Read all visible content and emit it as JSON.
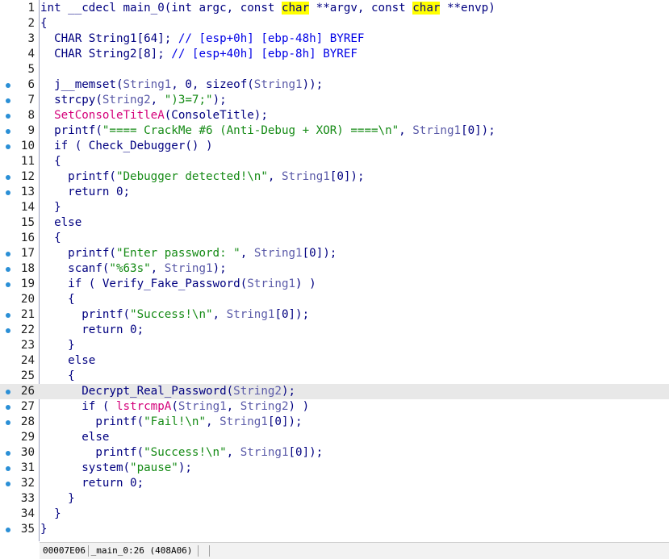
{
  "editor": {
    "highlighted_line": 26,
    "marker_color": "#2a8fd6",
    "lines": [
      {
        "num": "1",
        "dot": false,
        "tokens": [
          [
            "k",
            "int __cdecl main_0(int argc, const "
          ],
          [
            "y",
            "char"
          ],
          [
            "k",
            " **argv, const "
          ],
          [
            "y",
            "char"
          ],
          [
            "k",
            " **envp)"
          ]
        ]
      },
      {
        "num": "2",
        "dot": false,
        "tokens": [
          [
            "k",
            "{"
          ]
        ]
      },
      {
        "num": "3",
        "dot": false,
        "tokens": [
          [
            "k",
            "  CHAR String1[64]; "
          ],
          [
            "c",
            "// [esp+0h] [ebp-48h] BYREF"
          ]
        ]
      },
      {
        "num": "4",
        "dot": false,
        "tokens": [
          [
            "k",
            "  CHAR String2[8]; "
          ],
          [
            "c",
            "// [esp+40h] [ebp-8h] BYREF"
          ]
        ]
      },
      {
        "num": "5",
        "dot": false,
        "tokens": []
      },
      {
        "num": "6",
        "dot": true,
        "tokens": [
          [
            "k",
            "  j__memset("
          ],
          [
            "v",
            "String1"
          ],
          [
            "k",
            ", 0, sizeof("
          ],
          [
            "v",
            "String1"
          ],
          [
            "k",
            "));"
          ]
        ]
      },
      {
        "num": "7",
        "dot": true,
        "tokens": [
          [
            "k",
            "  strcpy("
          ],
          [
            "v",
            "String2"
          ],
          [
            "k",
            ", "
          ],
          [
            "s",
            "\")3=7;\""
          ],
          [
            "k",
            ");"
          ]
        ]
      },
      {
        "num": "8",
        "dot": true,
        "tokens": [
          [
            "k",
            "  "
          ],
          [
            "f",
            "SetConsoleTitleA"
          ],
          [
            "k",
            "(ConsoleTitle);"
          ]
        ]
      },
      {
        "num": "9",
        "dot": true,
        "tokens": [
          [
            "k",
            "  printf("
          ],
          [
            "s",
            "\"==== CrackMe #6 (Anti-Debug + XOR) ====\\n\""
          ],
          [
            "k",
            ", "
          ],
          [
            "v",
            "String1"
          ],
          [
            "k",
            "[0]);"
          ]
        ]
      },
      {
        "num": "10",
        "dot": true,
        "tokens": [
          [
            "k",
            "  if ( Check_Debugger() )"
          ]
        ]
      },
      {
        "num": "11",
        "dot": false,
        "tokens": [
          [
            "k",
            "  {"
          ]
        ]
      },
      {
        "num": "12",
        "dot": true,
        "tokens": [
          [
            "k",
            "    printf("
          ],
          [
            "s",
            "\"Debugger detected!\\n\""
          ],
          [
            "k",
            ", "
          ],
          [
            "v",
            "String1"
          ],
          [
            "k",
            "[0]);"
          ]
        ]
      },
      {
        "num": "13",
        "dot": true,
        "tokens": [
          [
            "k",
            "    return 0;"
          ]
        ]
      },
      {
        "num": "14",
        "dot": false,
        "tokens": [
          [
            "k",
            "  }"
          ]
        ]
      },
      {
        "num": "15",
        "dot": false,
        "tokens": [
          [
            "k",
            "  else"
          ]
        ]
      },
      {
        "num": "16",
        "dot": false,
        "tokens": [
          [
            "k",
            "  {"
          ]
        ]
      },
      {
        "num": "17",
        "dot": true,
        "tokens": [
          [
            "k",
            "    printf("
          ],
          [
            "s",
            "\"Enter password: \""
          ],
          [
            "k",
            ", "
          ],
          [
            "v",
            "String1"
          ],
          [
            "k",
            "[0]);"
          ]
        ]
      },
      {
        "num": "18",
        "dot": true,
        "tokens": [
          [
            "k",
            "    scanf("
          ],
          [
            "s",
            "\"%63s\""
          ],
          [
            "k",
            ", "
          ],
          [
            "v",
            "String1"
          ],
          [
            "k",
            ");"
          ]
        ]
      },
      {
        "num": "19",
        "dot": true,
        "tokens": [
          [
            "k",
            "    if ( Verify_Fake_Password("
          ],
          [
            "v",
            "String1"
          ],
          [
            "k",
            ") )"
          ]
        ]
      },
      {
        "num": "20",
        "dot": false,
        "tokens": [
          [
            "k",
            "    {"
          ]
        ]
      },
      {
        "num": "21",
        "dot": true,
        "tokens": [
          [
            "k",
            "      printf("
          ],
          [
            "s",
            "\"Success!\\n\""
          ],
          [
            "k",
            ", "
          ],
          [
            "v",
            "String1"
          ],
          [
            "k",
            "[0]);"
          ]
        ]
      },
      {
        "num": "22",
        "dot": true,
        "tokens": [
          [
            "k",
            "      return 0;"
          ]
        ]
      },
      {
        "num": "23",
        "dot": false,
        "tokens": [
          [
            "k",
            "    }"
          ]
        ]
      },
      {
        "num": "24",
        "dot": false,
        "tokens": [
          [
            "k",
            "    else"
          ]
        ]
      },
      {
        "num": "25",
        "dot": false,
        "tokens": [
          [
            "k",
            "    {"
          ]
        ]
      },
      {
        "num": "26",
        "dot": true,
        "tokens": [
          [
            "k",
            "      Decrypt_Real_Password("
          ],
          [
            "v",
            "String2"
          ],
          [
            "k",
            ");"
          ]
        ]
      },
      {
        "num": "27",
        "dot": true,
        "tokens": [
          [
            "k",
            "      if ( "
          ],
          [
            "f",
            "lstrcmpA"
          ],
          [
            "k",
            "("
          ],
          [
            "v",
            "String1"
          ],
          [
            "k",
            ", "
          ],
          [
            "v",
            "String2"
          ],
          [
            "k",
            ") )"
          ]
        ]
      },
      {
        "num": "28",
        "dot": true,
        "tokens": [
          [
            "k",
            "        printf("
          ],
          [
            "s",
            "\"Fail!\\n\""
          ],
          [
            "k",
            ", "
          ],
          [
            "v",
            "String1"
          ],
          [
            "k",
            "[0]);"
          ]
        ]
      },
      {
        "num": "29",
        "dot": false,
        "tokens": [
          [
            "k",
            "      else"
          ]
        ]
      },
      {
        "num": "30",
        "dot": true,
        "tokens": [
          [
            "k",
            "        printf("
          ],
          [
            "s",
            "\"Success!\\n\""
          ],
          [
            "k",
            ", "
          ],
          [
            "v",
            "String1"
          ],
          [
            "k",
            "[0]);"
          ]
        ]
      },
      {
        "num": "31",
        "dot": true,
        "tokens": [
          [
            "k",
            "      system("
          ],
          [
            "s",
            "\"pause\""
          ],
          [
            "k",
            ");"
          ]
        ]
      },
      {
        "num": "32",
        "dot": true,
        "tokens": [
          [
            "k",
            "      return 0;"
          ]
        ]
      },
      {
        "num": "33",
        "dot": false,
        "tokens": [
          [
            "k",
            "    }"
          ]
        ]
      },
      {
        "num": "34",
        "dot": false,
        "tokens": [
          [
            "k",
            "  }"
          ]
        ]
      },
      {
        "num": "35",
        "dot": true,
        "tokens": [
          [
            "k",
            "}"
          ]
        ]
      }
    ]
  },
  "status_bar": {
    "location": "00007E06 _main_0:26 (408A06)"
  }
}
